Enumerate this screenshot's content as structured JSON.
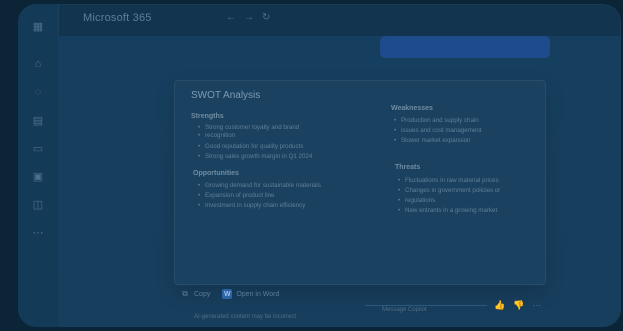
{
  "app": {
    "title": "Microsoft 365"
  },
  "card": {
    "title": "SWOT Analysis",
    "sections": [
      {
        "title": "Strengths",
        "items": [
          "Strong customer loyalty and brand",
          "recognition",
          "Good reputation for quality products",
          "Strong sales growth margin in Q1 2024"
        ]
      },
      {
        "title": "Weaknesses",
        "items": [
          "Production and supply chain",
          "issues and cost management",
          "Slower market expansion"
        ]
      },
      {
        "title": "Opportunities",
        "items": [
          "Growing demand for sustainable materials",
          "Expansion of product line",
          "Investment in supply chain efficiency"
        ]
      },
      {
        "title": "Threats",
        "items": [
          "Fluctuations in raw material prices",
          "Changes in government policies or",
          "regulations",
          "New entrants in a growing market"
        ]
      }
    ]
  },
  "footer": {
    "copy_label": "Copy",
    "open_word_label": "Open in Word"
  },
  "note": {
    "text": "AI-generated content may be incorrect"
  },
  "composer": {
    "placeholder": "Message Copilot"
  },
  "actions": {
    "thumbs_up_icon": "thumbs-up-icon",
    "thumbs_down_icon": "thumbs-down-icon",
    "more_icon": "more-icon"
  }
}
